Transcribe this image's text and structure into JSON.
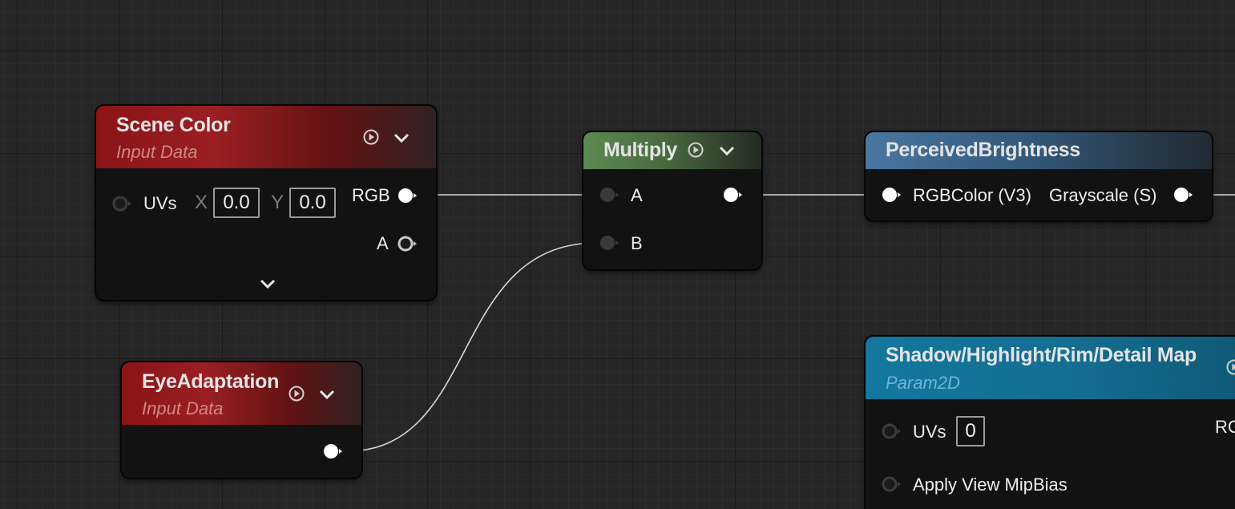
{
  "nodes": {
    "scene_color": {
      "title": "Scene Color",
      "subtitle": "Input Data",
      "uvs_label": "UVs",
      "x_label": "X",
      "x_value": "0.0",
      "y_label": "Y",
      "y_value": "0.0",
      "out_rgb": "RGB",
      "out_a": "A"
    },
    "eye_adaptation": {
      "title": "EyeAdaptation",
      "subtitle": "Input Data"
    },
    "multiply": {
      "title": "Multiply",
      "in_a": "A",
      "in_b": "B"
    },
    "perceived_brightness": {
      "title": "PerceivedBrightness",
      "in_rgbcolor": "RGBColor (V3)",
      "out_grayscale": "Grayscale (S)"
    },
    "shadow_map": {
      "title": "Shadow/Highlight/Rim/Detail Map",
      "subtitle": "Param2D",
      "uvs_label": "UVs",
      "uvs_value": "0",
      "mipbias_label": "Apply View MipBias",
      "out_partial": "RG"
    }
  },
  "colors": {
    "input_data_header": "#8a1416",
    "multiply_header": "#5c8a52",
    "function_header": "#4a76a0",
    "param_header": "#13779e",
    "wire": "#d8d8d8",
    "connected_pin": "#ffffff",
    "unconnected_pin": "#3a3a3a"
  }
}
